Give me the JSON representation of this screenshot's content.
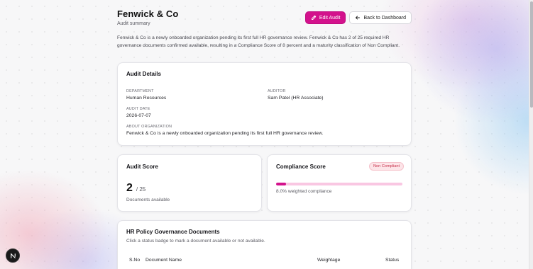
{
  "org": {
    "title": "Fenwick & Co",
    "subtitle": "Audit summary",
    "intro": "Fenwick & Co is a newly onboarded organization pending its first full HR governance review. Fenwick & Co has 2 of 25 required HR governance documents confirmed available, resulting in a Compliance Score of 8 percent and a maturity classification of Non Compliant."
  },
  "actions": {
    "edit_label": "Edit Audit",
    "back_label": "Back to Dashboard"
  },
  "details": {
    "title": "Audit Details",
    "department_label": "DEPARTMENT",
    "department_value": "Human Resources",
    "auditor_label": "AUDITOR",
    "auditor_value": "Sam Patel (HR Associate)",
    "date_label": "AUDIT DATE",
    "date_value": "2026-07-07",
    "about_label": "ABOUT ORGANIZATION",
    "about_value": "Fenwick & Co is a newly onboarded organization pending its first full HR governance review."
  },
  "audit_score": {
    "title": "Audit Score",
    "score": "2",
    "total": "/ 25",
    "caption": "Documents available"
  },
  "compliance": {
    "title": "Compliance Score",
    "badge": "Non Compliant",
    "progress_percent": 8.0,
    "caption": "8.0% weighted compliance"
  },
  "documents": {
    "title": "HR Policy Governance Documents",
    "hint": "Click a status badge to mark a document available or not available.",
    "columns": [
      "S.No",
      "Document Name",
      "Weightage",
      "Status"
    ]
  },
  "colors": {
    "accent": "#d3128c",
    "badge_text": "#c6314b",
    "badge_bg": "#fde4e8"
  }
}
